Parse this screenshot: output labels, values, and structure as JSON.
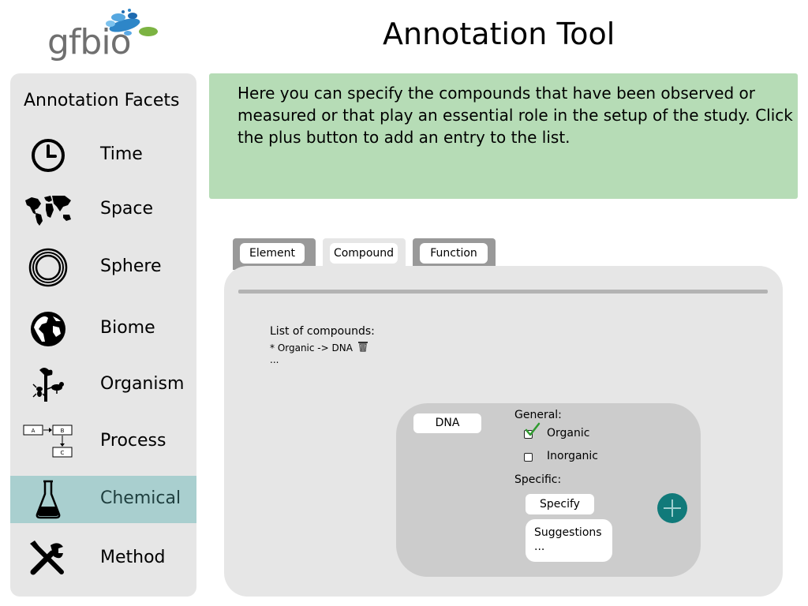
{
  "logo": {
    "text": "gfbio"
  },
  "app_title": "Annotation Tool",
  "sidebar": {
    "title": "Annotation Facets",
    "items": [
      {
        "label": "Time",
        "icon": "clock-icon",
        "active": false
      },
      {
        "label": "Space",
        "icon": "world-map-icon",
        "active": false
      },
      {
        "label": "Sphere",
        "icon": "concentric-circles-icon",
        "active": false
      },
      {
        "label": "Biome",
        "icon": "globe-icon",
        "active": false
      },
      {
        "label": "Organism",
        "icon": "tree-ant-bird-icon",
        "active": false
      },
      {
        "label": "Process",
        "icon": "process-flow-icon",
        "active": false
      },
      {
        "label": "Chemical",
        "icon": "flask-icon",
        "active": true
      },
      {
        "label": "Method",
        "icon": "tools-icon",
        "active": false
      }
    ],
    "process_icon_labels": [
      "A",
      "B",
      "C"
    ]
  },
  "info": {
    "text": "Here you can specify the compounds that have been observed or measured or that play an essential role in the setup of the study. Click the plus button to add an entry to the list."
  },
  "tabs": [
    {
      "label": "Element",
      "active": false
    },
    {
      "label": "Compound",
      "active": true
    },
    {
      "label": "Function",
      "active": false
    }
  ],
  "compounds": {
    "list_label": "List of compounds:",
    "entries": [
      "* Organic -> DNA"
    ],
    "more": "..."
  },
  "editor": {
    "name_value": "DNA",
    "general_label": "General:",
    "options": [
      {
        "label": "Organic",
        "checked": true
      },
      {
        "label": "Inorganic",
        "checked": false
      }
    ],
    "specific_label": "Specific:",
    "specify_label": "Specify",
    "suggestions_title": "Suggestions",
    "suggestions_more": "..."
  },
  "colors": {
    "active_facet": "#a9cfcf",
    "info_banner": "#b6dcb6",
    "add_button": "#117a7a",
    "checkmark": "#2f9a2f"
  }
}
